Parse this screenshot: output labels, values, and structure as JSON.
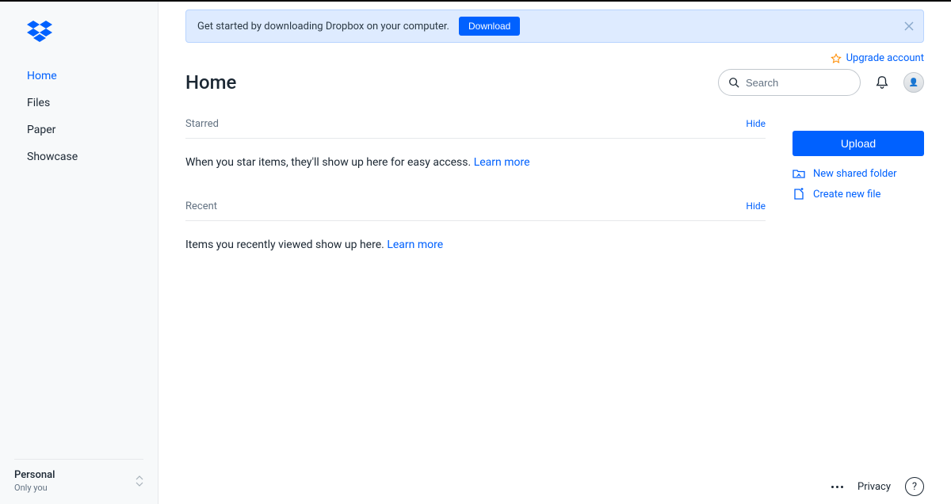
{
  "colors": {
    "accent": "#0061ff",
    "link": "#0061fe",
    "muted": "#637282",
    "bannerBg": "#deebff"
  },
  "sidebar": {
    "nav": [
      {
        "label": "Home",
        "active": true
      },
      {
        "label": "Files",
        "active": false
      },
      {
        "label": "Paper",
        "active": false
      },
      {
        "label": "Showcase",
        "active": false
      }
    ],
    "account": {
      "title": "Personal",
      "subtitle": "Only you"
    }
  },
  "banner": {
    "text": "Get started by downloading Dropbox on your computer.",
    "button": "Download"
  },
  "upgrade": {
    "label": "Upgrade account"
  },
  "header": {
    "title": "Home",
    "searchPlaceholder": "Search"
  },
  "sections": {
    "starred": {
      "title": "Starred",
      "hide": "Hide",
      "empty": "When you star items, they'll show up here for easy access.",
      "learn": "Learn more"
    },
    "recent": {
      "title": "Recent",
      "hide": "Hide",
      "empty": "Items you recently viewed show up here.",
      "learn": "Learn more"
    }
  },
  "actions": {
    "upload": "Upload",
    "sharedFolder": "New shared folder",
    "newFile": "Create new file"
  },
  "footer": {
    "privacy": "Privacy",
    "help": "?"
  }
}
